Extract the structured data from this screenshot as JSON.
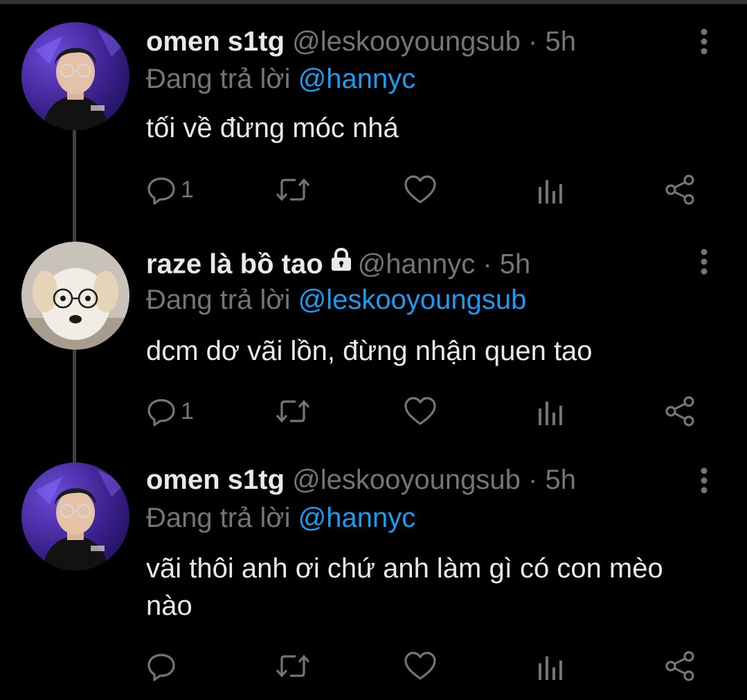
{
  "tweets": [
    {
      "name": "omen s1tg",
      "handle": "@leskooyoungsub",
      "time": "· 5h",
      "replying_prefix": "Đang trả lời ",
      "replying_to": "@hannyc",
      "text": "tối về đừng móc nhá",
      "reply_count": "1",
      "locked": false,
      "avatar": "person-with-glasses-avatar"
    },
    {
      "name": "raze là bồ tao",
      "handle": "@hannyc",
      "time": "· 5h",
      "replying_prefix": "Đang trả lời ",
      "replying_to": "@leskooyoungsub",
      "text": "dcm dơ vãi lồn, đừng nhận quen tao",
      "reply_count": "1",
      "locked": true,
      "avatar": "puppy-with-glasses-avatar"
    },
    {
      "name": "omen s1tg",
      "handle": "@leskooyoungsub",
      "time": "· 5h",
      "replying_prefix": "Đang trả lời ",
      "replying_to": "@hannyc",
      "text": "vãi thôi anh ơi chứ anh làm gì có con mèo nào",
      "reply_count": "",
      "locked": false,
      "avatar": "person-with-glasses-avatar"
    }
  ],
  "icons": {
    "reply": "comment-icon",
    "retweet": "retweet-icon",
    "like": "heart-icon",
    "views": "bar-chart-icon",
    "share": "share-icon",
    "more": "more-vertical-icon",
    "lock": "lock-icon"
  },
  "colors": {
    "background": "#000000",
    "text": "#e7e9ea",
    "secondary": "#71767b",
    "mention": "#1d9bf0"
  }
}
